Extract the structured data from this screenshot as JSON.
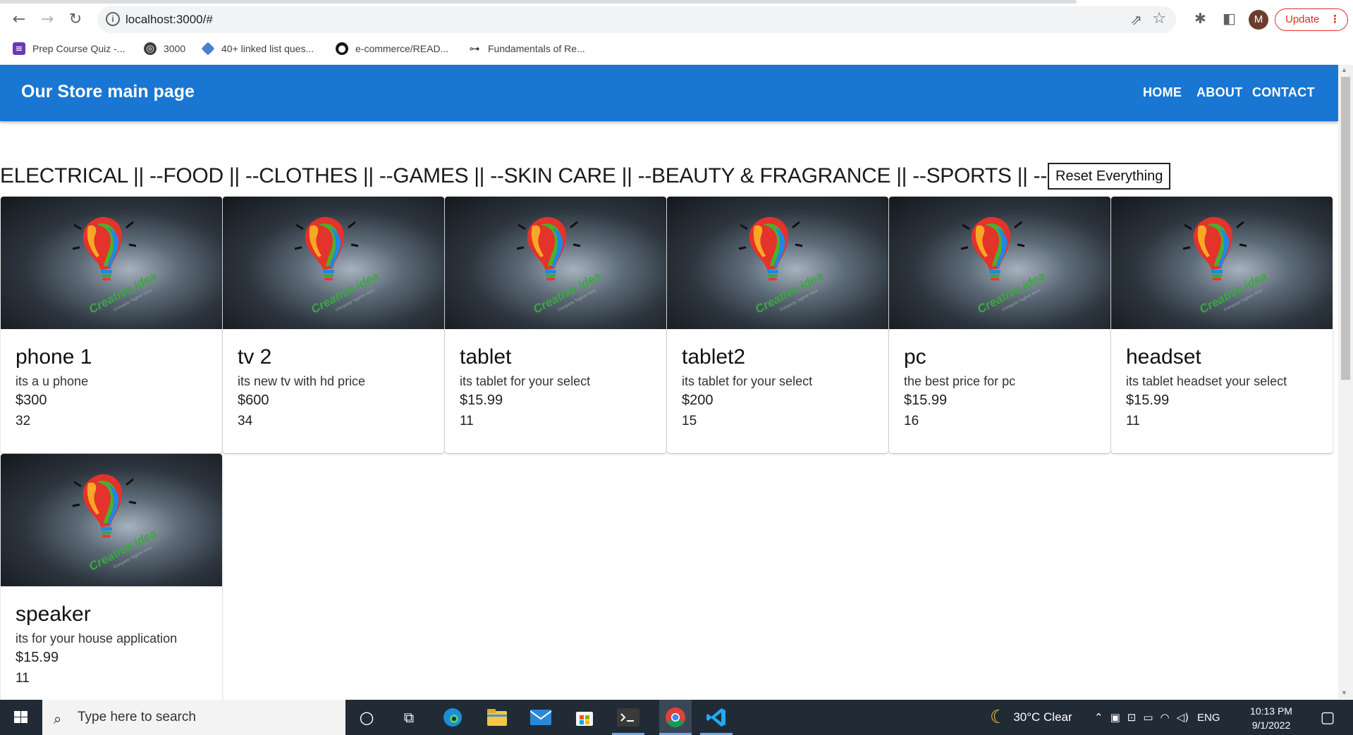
{
  "browser": {
    "url": "localhost:3000/#",
    "update_label": "Update",
    "avatar_letter": "M",
    "bookmarks": [
      {
        "label": "Prep Course Quiz -...",
        "icon": "forms-icon"
      },
      {
        "label": "3000",
        "icon": "globe-icon"
      },
      {
        "label": "40+ linked list ques...",
        "icon": "diamond-icon"
      },
      {
        "label": "e-commerce/READ...",
        "icon": "github-icon"
      },
      {
        "label": "Fundamentals of Re...",
        "icon": "glasses-icon"
      }
    ]
  },
  "app": {
    "title": "Our Store main page",
    "nav": [
      "HOME",
      "ABOUT",
      "CONTACT"
    ],
    "categories_text": "ELECTRICAL || --FOOD || --CLOTHES || --GAMES || --SKIN CARE || --BEAUTY & FRAGRANCE || --SPORTS || --",
    "reset_label": "Reset Everything",
    "image_caption": "Creative idea",
    "image_tagline": "Company Tagline Here",
    "products": [
      {
        "name": "phone 1",
        "desc": "its a u phone",
        "price": "$300",
        "qty": "32"
      },
      {
        "name": "tv 2",
        "desc": "its new tv with hd price",
        "price": "$600",
        "qty": "34"
      },
      {
        "name": "tablet",
        "desc": "its tablet for your select",
        "price": "$15.99",
        "qty": "11"
      },
      {
        "name": "tablet2",
        "desc": "its tablet for your select",
        "price": "$200",
        "qty": "15"
      },
      {
        "name": "pc",
        "desc": "the best price for pc",
        "price": "$15.99",
        "qty": "16"
      },
      {
        "name": "headset",
        "desc": "its tablet headset your select",
        "price": "$15.99",
        "qty": "11"
      },
      {
        "name": "speaker",
        "desc": "its for your house application",
        "price": "$15.99",
        "qty": "11"
      }
    ]
  },
  "taskbar": {
    "search_placeholder": "Type here to search",
    "weather": "30°C  Clear",
    "language": "ENG",
    "time": "10:13 PM",
    "date": "9/1/2022"
  },
  "colors": {
    "app_bar": "#1976d2",
    "update_red": "#d93025",
    "taskbar": "#202b36"
  }
}
